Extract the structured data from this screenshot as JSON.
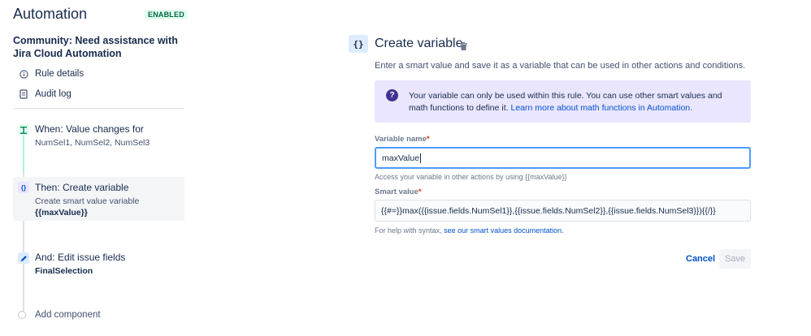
{
  "header": {
    "title": "Automation",
    "status": "ENABLED",
    "rule_name": "Community: Need assistance with Jira Cloud Automation"
  },
  "nav": {
    "rule_details": "Rule details",
    "audit_log": "Audit log"
  },
  "steps": {
    "when": {
      "title": "When: Value changes for",
      "detail": "NumSel1, NumSel2, NumSel3",
      "icon": "trigger-icon"
    },
    "then": {
      "title": "Then: Create variable",
      "detail": "Create smart value variable",
      "value": "{{maxValue}}",
      "icon": "braces-icon"
    },
    "and": {
      "title": "And: Edit issue fields",
      "value": "FinalSelection",
      "icon": "pencil-icon"
    },
    "add": "Add component"
  },
  "panel": {
    "icon_glyph": "{}",
    "title": "Create variable",
    "description": "Enter a smart value and save it as a variable that can be used in other actions and conditions.",
    "info_text": "Your variable can only be used within this rule. You can use other smart values and math functions to define it.",
    "info_link": "Learn more about math functions in Automation.",
    "variable_name": {
      "label": "Variable name",
      "required_mark": "*",
      "value": "maxValue",
      "help": "Access your variable in other actions by using {{maxValue}}"
    },
    "smart_value": {
      "label": "Smart value",
      "required_mark": "*",
      "value": "{{#=}}max({{issue.fields.NumSel1}},{{issue.fields.NumSel2}},{{issue.fields.NumSel3}}){{/}}",
      "help_prefix": "For help with syntax,",
      "help_link": "see our smart values documentation."
    },
    "cancel_label": "Cancel",
    "save_label": "Save"
  },
  "colors": {
    "accent": "#0052cc",
    "enabled_bg": "#e3fcef",
    "enabled_text": "#006644",
    "info_bg": "#eae6ff",
    "focus_border": "#4c9aff"
  }
}
